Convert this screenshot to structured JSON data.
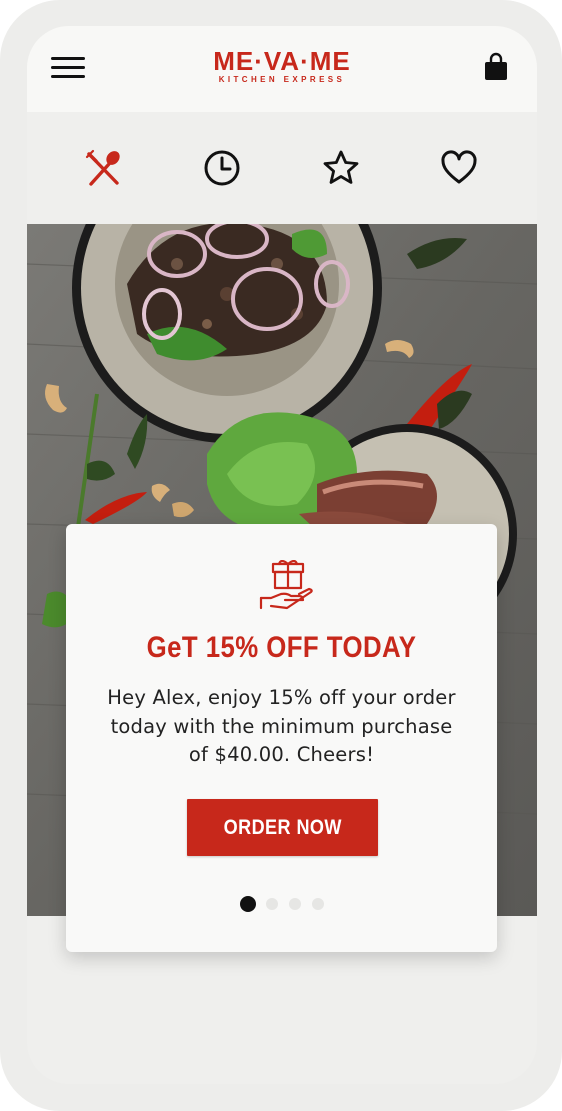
{
  "header": {
    "logo_main": "ME·VA·ME",
    "logo_sub": "KITCHEN EXPRESS",
    "menu_icon": "hamburger-menu-icon",
    "cart_icon": "shopping-bag-icon"
  },
  "tabs": [
    {
      "icon": "fork-spoon-icon",
      "active": true
    },
    {
      "icon": "clock-icon",
      "active": false
    },
    {
      "icon": "star-icon",
      "active": false
    },
    {
      "icon": "heart-icon",
      "active": false
    }
  ],
  "hero": {
    "image": "food-photo"
  },
  "promo": {
    "icon": "gift-hand-icon",
    "title": "GeT 15% OFF TODAY",
    "body": "Hey Alex, enjoy 15% off your order today with the minimum purchase of $40.00. Cheers!",
    "button_label": "ORDER NOW"
  },
  "carousel": {
    "total": 4,
    "active_index": 0
  },
  "colors": {
    "brand": "#c7281b",
    "text": "#222222",
    "icon": "#111111"
  }
}
